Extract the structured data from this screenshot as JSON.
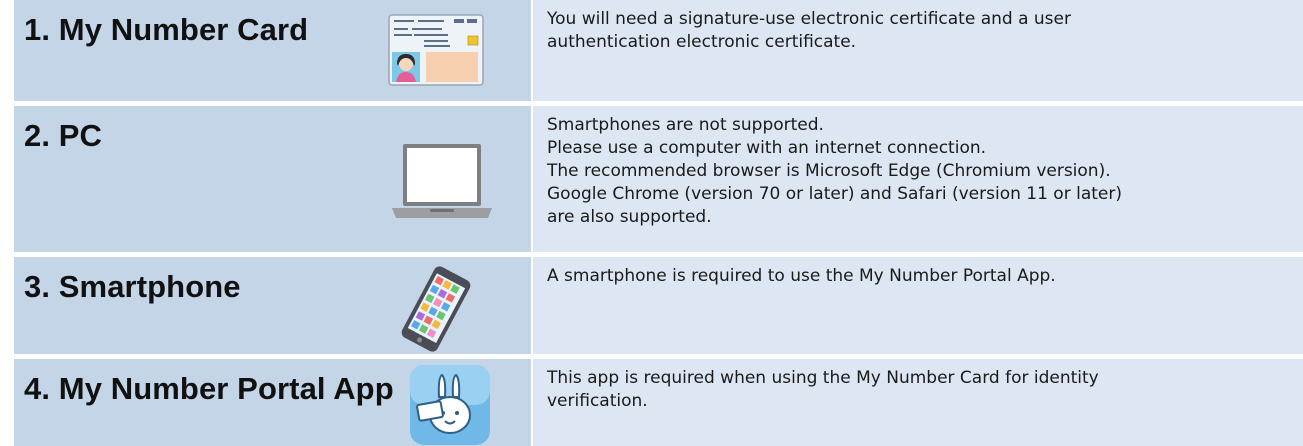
{
  "rows": [
    {
      "title": "1.  My Number Card",
      "icon": "my-number-card-icon",
      "lines": [
        "You will need a signature-use electronic certificate and a user",
        "authentication electronic certificate."
      ]
    },
    {
      "title": "2. PC",
      "icon": "laptop-icon",
      "lines": [
        "Smartphones are not supported.",
        "Please use a computer with an internet connection.",
        "The recommended browser is Microsoft Edge (Chromium version).",
        "Google Chrome (version 70 or later) and Safari (version 11 or later)",
        "are also supported."
      ]
    },
    {
      "title": "3. Smartphone",
      "icon": "smartphone-icon",
      "lines": [
        "A smartphone is required to use the My Number Portal App."
      ]
    },
    {
      "title": "4. My Number Portal App",
      "icon": "portal-app-rabbit-icon",
      "lines": [
        "This app is required when using the My Number Card for identity",
        "verification."
      ]
    }
  ],
  "colors": {
    "left_cell": "#c4d5e8",
    "right_cell": "#dde7f3"
  }
}
